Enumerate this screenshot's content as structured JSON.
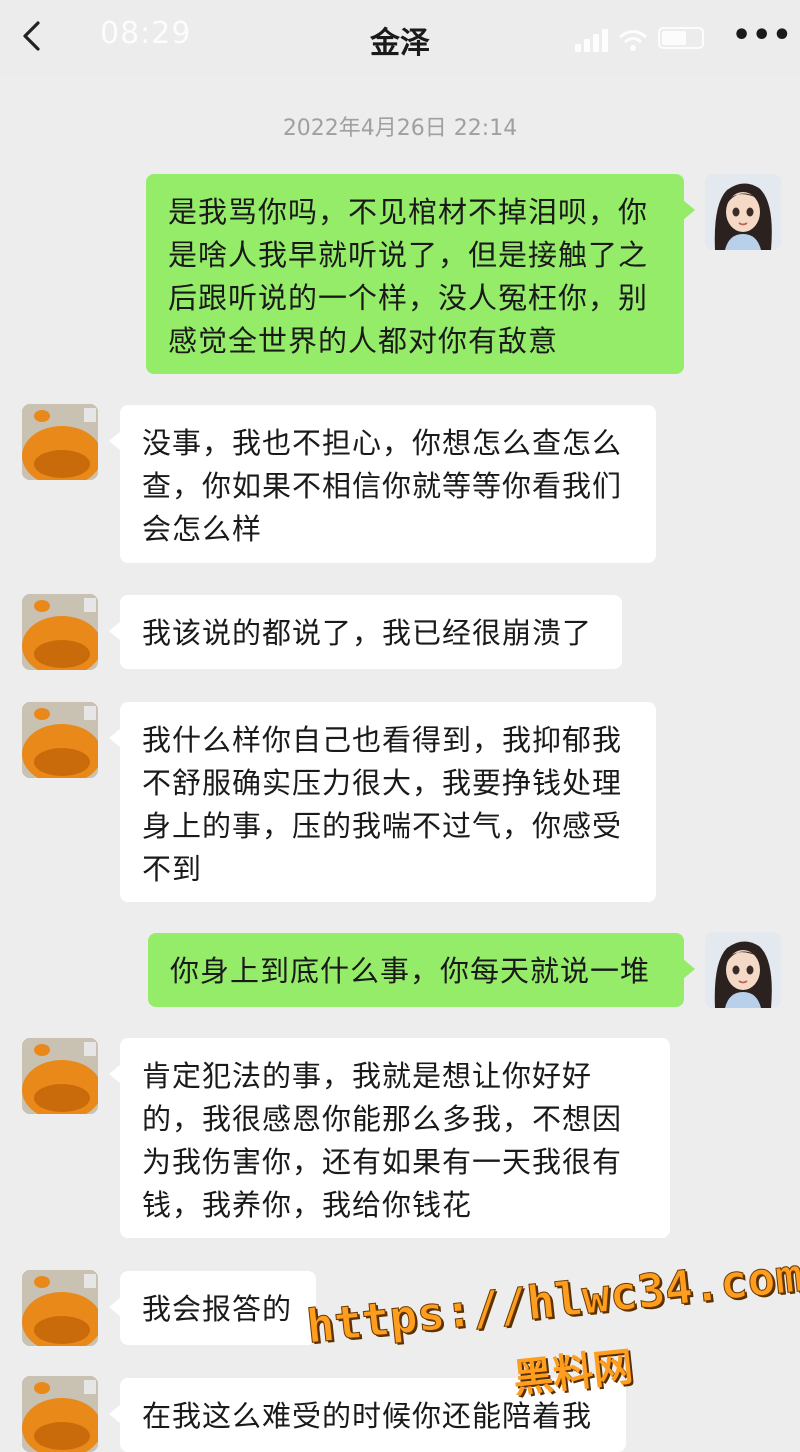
{
  "status_bar": {
    "time": "08:29"
  },
  "header": {
    "title": "金泽",
    "back_icon": "chevron-left-icon",
    "more_label": "•••"
  },
  "timestamp": "2022年4月26日 22:14",
  "messages": [
    {
      "sender": "me",
      "text": "是我骂你吗，不见棺材不掉泪呗，你是啥人我早就听说了，但是接触了之后跟听说的一个样，没人冤枉你，别感觉全世界的人都对你有敌意"
    },
    {
      "sender": "other",
      "text": "没事，我也不担心，你想怎么查怎么查，你如果不相信你就等等你看我们会怎么样"
    },
    {
      "sender": "other",
      "text": "我该说的都说了，我已经很崩溃了"
    },
    {
      "sender": "other",
      "text": "我什么样你自己也看得到，我抑郁我不舒服确实压力很大，我要挣钱处理身上的事，压的我喘不过气，你感受不到"
    },
    {
      "sender": "me",
      "text": "你身上到底什么事，你每天就说一堆"
    },
    {
      "sender": "other",
      "text": "肯定犯法的事，我就是想让你好好的，我很感恩你能那么多我，不想因为我伤害你，还有如果有一天我很有钱，我养你，我给你钱花"
    },
    {
      "sender": "other",
      "text": "我会报答的"
    },
    {
      "sender": "other",
      "text": "在我这么难受的时候你还能陪着我"
    }
  ],
  "watermark": {
    "url": "https://hlwc34.com",
    "label": "黑料网"
  },
  "colors": {
    "self_bubble": "#95ec69",
    "other_bubble": "#ffffff",
    "background": "#ededed"
  }
}
